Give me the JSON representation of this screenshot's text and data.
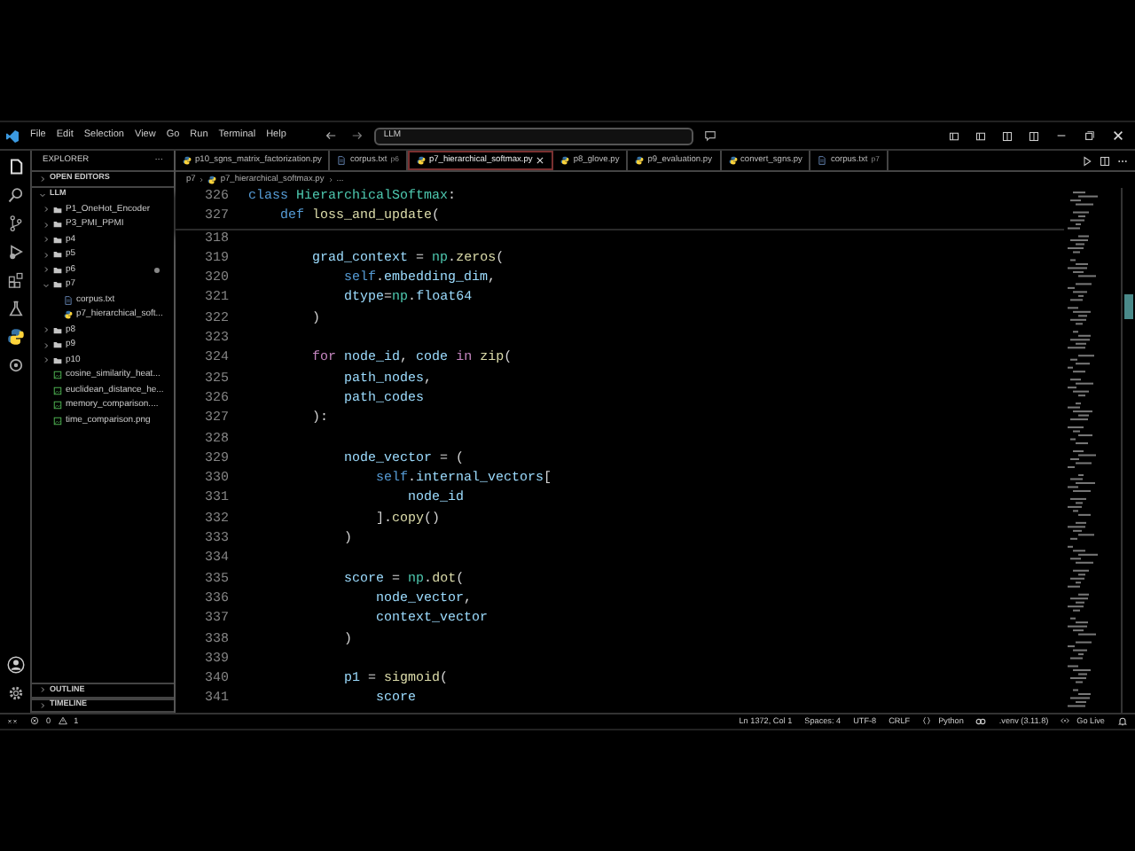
{
  "title_bar": {
    "menu": [
      "File",
      "Edit",
      "Selection",
      "View",
      "Go",
      "Run",
      "Terminal",
      "Help"
    ],
    "search": "LLM"
  },
  "sidebar": {
    "title": "EXPLORER",
    "more": "···",
    "sections": [
      {
        "label": "OPEN EDITORS",
        "expanded": false
      }
    ],
    "root": {
      "label": "LLM",
      "expanded": true,
      "children": [
        {
          "label": "P1_OneHot_Encoder",
          "kind": "folder",
          "expanded": false,
          "modified": false
        },
        {
          "label": "P3_PMI_PPMI",
          "kind": "folder",
          "expanded": false,
          "modified": false
        },
        {
          "label": "p4",
          "kind": "folder",
          "expanded": false,
          "modified": false
        },
        {
          "label": "p5",
          "kind": "folder",
          "expanded": false,
          "modified": false
        },
        {
          "label": "p6",
          "kind": "folder",
          "expanded": false,
          "modified": true
        },
        {
          "label": "p7",
          "kind": "folder",
          "expanded": true,
          "modified": false,
          "children": [
            {
              "label": "corpus.txt",
              "kind": "text",
              "modified": false
            },
            {
              "label": "p7_hierarchical_soft...",
              "kind": "python",
              "modified": false
            }
          ]
        },
        {
          "label": "p8",
          "kind": "folder",
          "expanded": false,
          "modified": false
        },
        {
          "label": "p9",
          "kind": "folder",
          "expanded": false,
          "modified": false
        },
        {
          "label": "p10",
          "kind": "folder",
          "expanded": false,
          "modified": false
        },
        {
          "label": "cosine_similarity_heat...",
          "kind": "image",
          "modified": false
        },
        {
          "label": "euclidean_distance_he...",
          "kind": "image",
          "modified": false
        },
        {
          "label": "memory_comparison....",
          "kind": "image",
          "modified": false
        },
        {
          "label": "time_comparison.png",
          "kind": "image",
          "modified": false
        }
      ]
    },
    "bottom_sections": [
      {
        "label": "OUTLINE",
        "expanded": false
      },
      {
        "label": "TIMELINE",
        "expanded": false
      }
    ]
  },
  "tabs": [
    {
      "label": "p10_sgns_matrix_factorization.py",
      "kind": "python",
      "selected": false
    },
    {
      "label": "corpus.txt",
      "detail": "p6",
      "kind": "text",
      "selected": false
    },
    {
      "label": "p7_hierarchical_softmax.py",
      "kind": "python",
      "selected": true
    },
    {
      "label": "p8_glove.py",
      "kind": "python",
      "selected": false
    },
    {
      "label": "p9_evaluation.py",
      "kind": "python",
      "selected": false
    },
    {
      "label": "convert_sgns.py",
      "kind": "python",
      "selected": false
    },
    {
      "label": "corpus.txt",
      "detail": "p7",
      "kind": "text",
      "selected": false
    }
  ],
  "breadcrumb": [
    "p7",
    "p7_hierarchical_softmax.py",
    "..."
  ],
  "sticky_lines": [
    {
      "number": "326",
      "tokens": [
        {
          "kind": "keyword",
          "text": "class "
        },
        {
          "kind": "type",
          "text": "HierarchicalSoftmax"
        },
        {
          "kind": "plain",
          "text": ":"
        }
      ]
    },
    {
      "number": "327",
      "tokens": [
        {
          "kind": "keyword",
          "text": "    def "
        },
        {
          "kind": "function",
          "text": "loss_and_update"
        },
        {
          "kind": "plain",
          "text": "("
        }
      ]
    }
  ],
  "lines": [
    {
      "number": "318"
    },
    {
      "number": "319",
      "tokens": [
        {
          "kind": "variable",
          "text": "        grad_context"
        },
        {
          "kind": "plain",
          "text": " = "
        },
        {
          "kind": "type",
          "text": "np"
        },
        {
          "kind": "plain",
          "text": "."
        },
        {
          "kind": "function",
          "text": "zeros"
        },
        {
          "kind": "plain",
          "text": "("
        }
      ]
    },
    {
      "number": "320",
      "tokens": [
        {
          "kind": "keyword",
          "text": "            self"
        },
        {
          "kind": "plain",
          "text": "."
        },
        {
          "kind": "variable",
          "text": "embedding_dim"
        },
        {
          "kind": "plain",
          "text": ","
        }
      ]
    },
    {
      "number": "321",
      "tokens": [
        {
          "kind": "variable",
          "text": "            dtype"
        },
        {
          "kind": "plain",
          "text": "="
        },
        {
          "kind": "type",
          "text": "np"
        },
        {
          "kind": "plain",
          "text": "."
        },
        {
          "kind": "variable",
          "text": "float64"
        }
      ]
    },
    {
      "number": "322",
      "tokens": [
        {
          "kind": "plain",
          "text": "        )"
        }
      ]
    },
    {
      "number": "323"
    },
    {
      "number": "324",
      "tokens": [
        {
          "kind": "control",
          "text": "        for "
        },
        {
          "kind": "variable",
          "text": "node_id"
        },
        {
          "kind": "plain",
          "text": ", "
        },
        {
          "kind": "variable",
          "text": "code "
        },
        {
          "kind": "control",
          "text": "in "
        },
        {
          "kind": "function",
          "text": "zip"
        },
        {
          "kind": "plain",
          "text": "("
        }
      ]
    },
    {
      "number": "325",
      "tokens": [
        {
          "kind": "variable",
          "text": "            path_nodes"
        },
        {
          "kind": "plain",
          "text": ","
        }
      ]
    },
    {
      "number": "326",
      "tokens": [
        {
          "kind": "variable",
          "text": "            path_codes"
        }
      ]
    },
    {
      "number": "327",
      "tokens": [
        {
          "kind": "plain",
          "text": "        ):"
        }
      ]
    },
    {
      "number": "328"
    },
    {
      "number": "329",
      "tokens": [
        {
          "kind": "variable",
          "text": "            node_vector"
        },
        {
          "kind": "plain",
          "text": " = ("
        }
      ]
    },
    {
      "number": "330",
      "tokens": [
        {
          "kind": "keyword",
          "text": "                self"
        },
        {
          "kind": "plain",
          "text": "."
        },
        {
          "kind": "variable",
          "text": "internal_vectors"
        },
        {
          "kind": "plain",
          "text": "["
        }
      ]
    },
    {
      "number": "331",
      "tokens": [
        {
          "kind": "variable",
          "text": "                    node_id"
        }
      ]
    },
    {
      "number": "332",
      "tokens": [
        {
          "kind": "plain",
          "text": "                ]."
        },
        {
          "kind": "function",
          "text": "copy"
        },
        {
          "kind": "plain",
          "text": "()"
        }
      ]
    },
    {
      "number": "333",
      "tokens": [
        {
          "kind": "plain",
          "text": "            )"
        }
      ]
    },
    {
      "number": "334"
    },
    {
      "number": "335",
      "tokens": [
        {
          "kind": "variable",
          "text": "            score"
        },
        {
          "kind": "plain",
          "text": " = "
        },
        {
          "kind": "type",
          "text": "np"
        },
        {
          "kind": "plain",
          "text": "."
        },
        {
          "kind": "function",
          "text": "dot"
        },
        {
          "kind": "plain",
          "text": "("
        }
      ]
    },
    {
      "number": "336",
      "tokens": [
        {
          "kind": "variable",
          "text": "                node_vector"
        },
        {
          "kind": "plain",
          "text": ","
        }
      ]
    },
    {
      "number": "337",
      "tokens": [
        {
          "kind": "variable",
          "text": "                context_vector"
        }
      ]
    },
    {
      "number": "338",
      "tokens": [
        {
          "kind": "plain",
          "text": "            )"
        }
      ]
    },
    {
      "number": "339"
    },
    {
      "number": "340",
      "tokens": [
        {
          "kind": "variable",
          "text": "            p1"
        },
        {
          "kind": "plain",
          "text": " = "
        },
        {
          "kind": "function",
          "text": "sigmoid"
        },
        {
          "kind": "plain",
          "text": "("
        }
      ]
    },
    {
      "number": "341",
      "tokens": [
        {
          "kind": "variable",
          "text": "                score"
        }
      ]
    }
  ],
  "status_bar": {
    "errors": "0",
    "warnings": "1",
    "right": [
      {
        "kind": "text",
        "text": "Ln 1372, Col 1"
      },
      {
        "kind": "text",
        "text": "Spaces: 4"
      },
      {
        "kind": "text",
        "text": "UTF-8"
      },
      {
        "kind": "text",
        "text": "CRLF"
      },
      {
        "kind": "language",
        "text": "Python"
      },
      {
        "kind": "copilot"
      },
      {
        "kind": "text",
        "text": ".venv (3.11.8)"
      },
      {
        "kind": "live",
        "text": "Go Live"
      },
      {
        "kind": "bell"
      }
    ]
  }
}
